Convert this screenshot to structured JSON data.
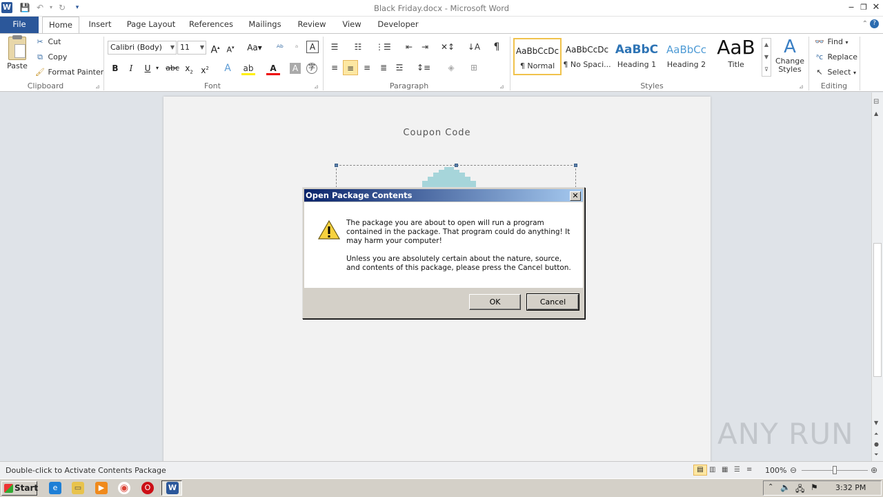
{
  "window": {
    "title": "Black Friday.docx - Microsoft Word"
  },
  "tabs": [
    "File",
    "Home",
    "Insert",
    "Page Layout",
    "References",
    "Mailings",
    "Review",
    "View",
    "Developer"
  ],
  "clipboard": {
    "paste": "Paste",
    "cut": "Cut",
    "copy": "Copy",
    "format_painter": "Format Painter",
    "label": "Clipboard"
  },
  "font": {
    "name": "Calibri (Body)",
    "size": "11",
    "label": "Font"
  },
  "paragraph": {
    "label": "Paragraph"
  },
  "styles": {
    "label": "Styles",
    "items": [
      {
        "preview": "AaBbCcDc",
        "name": "¶ Normal"
      },
      {
        "preview": "AaBbCcDc",
        "name": "¶ No Spaci..."
      },
      {
        "preview": "AaBbC",
        "name": "Heading 1"
      },
      {
        "preview": "AaBbCc",
        "name": "Heading 2"
      },
      {
        "preview": "AaB",
        "name": "Title"
      }
    ],
    "change_styles": "Change Styles"
  },
  "editing": {
    "find": "Find",
    "replace": "Replace",
    "select": "Select",
    "label": "Editing"
  },
  "document": {
    "coupon_text": "Coupon Code"
  },
  "dialog": {
    "title": "Open Package Contents",
    "close": "✕",
    "message1": "The package you are about to open will run a program contained in the package. That program could do anything!  It may harm your computer!",
    "message2": "Unless you are absolutely certain about the nature, source, and contents of this package, please press the Cancel button.",
    "ok": "OK",
    "cancel": "Cancel"
  },
  "status": {
    "text": "Double-click to Activate Contents Package",
    "zoom": "100%"
  },
  "taskbar": {
    "start": "Start",
    "clock": "3:32 PM"
  },
  "watermark": "ANY RUN",
  "colors": {
    "file_tab": "#2b579a",
    "dialog_title_start": "#0a246a",
    "dialog_title_end": "#a6caf0",
    "shape_fill": "#a6d5da"
  }
}
